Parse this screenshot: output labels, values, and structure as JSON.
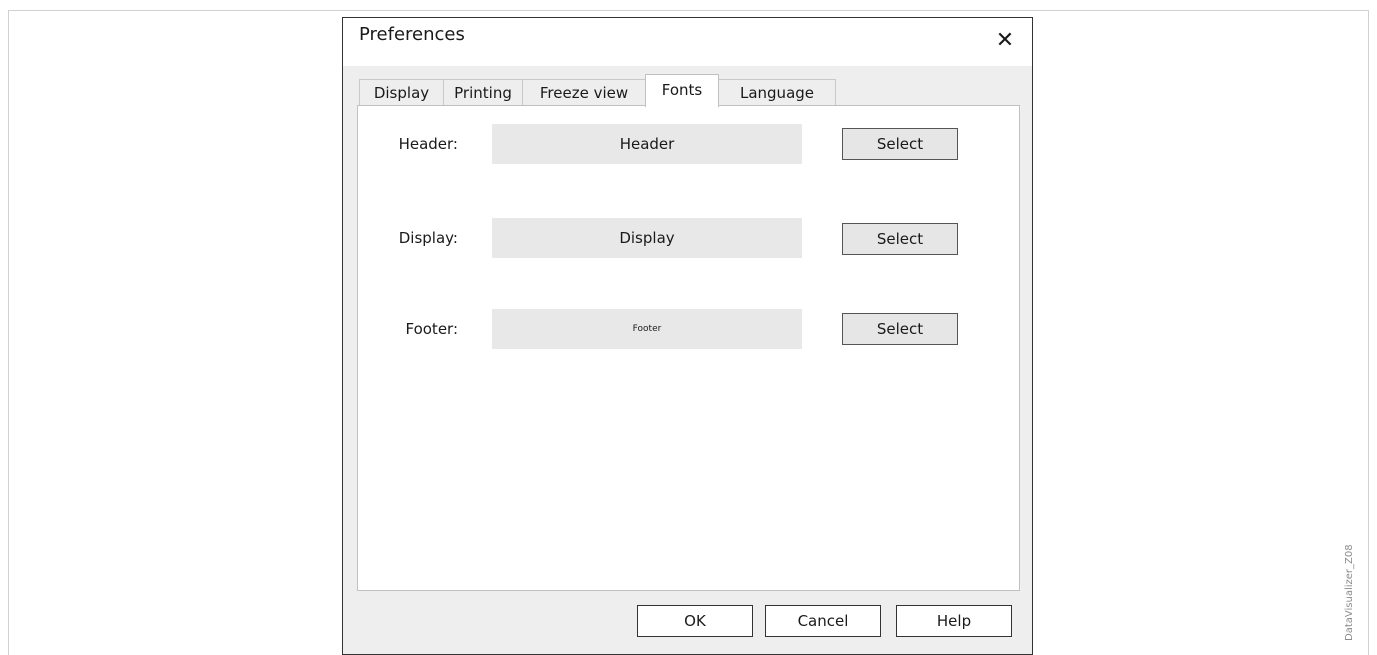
{
  "watermark": "DataVisualizer_Z08",
  "dialog": {
    "title": "Preferences",
    "close_glyph": "✕"
  },
  "tabs": [
    {
      "label": "Display",
      "active": false
    },
    {
      "label": "Printing",
      "active": false
    },
    {
      "label": "Freeze view",
      "active": false
    },
    {
      "label": "Fonts",
      "active": true
    },
    {
      "label": "Language",
      "active": false
    }
  ],
  "fonts": {
    "rows": [
      {
        "label": "Header:",
        "preview": "Header",
        "button": "Select"
      },
      {
        "label": "Display:",
        "preview": "Display",
        "button": "Select"
      },
      {
        "label": "Footer:",
        "preview": "Footer",
        "button": "Select"
      }
    ]
  },
  "buttons": {
    "ok": "OK",
    "cancel": "Cancel",
    "help": "Help"
  }
}
